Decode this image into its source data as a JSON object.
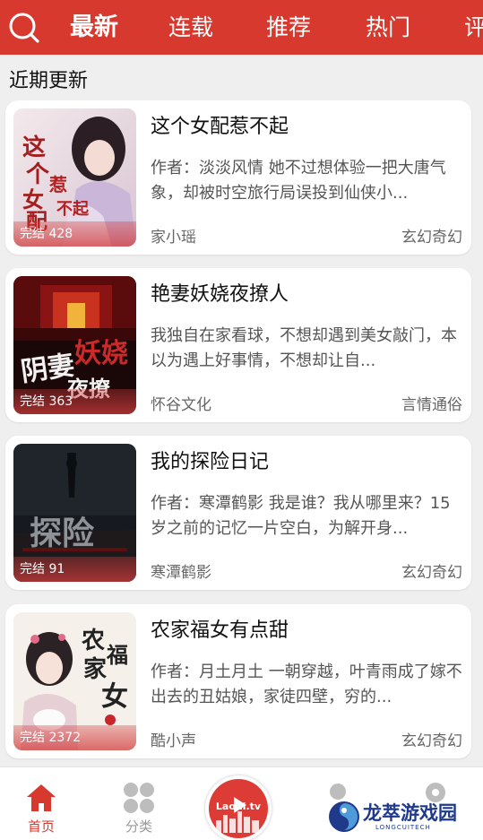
{
  "header": {
    "tabs": [
      {
        "label": "最新",
        "active": true
      },
      {
        "label": "连载",
        "active": false
      },
      {
        "label": "推荐",
        "active": false
      },
      {
        "label": "热门",
        "active": false
      },
      {
        "label": "评",
        "active": false
      }
    ],
    "search_icon": "search-icon",
    "accent_color": "#d8392f"
  },
  "section": {
    "title": "近期更新"
  },
  "books": [
    {
      "title": "这个女配惹不起",
      "description": "作者：淡淡风情 她不过想体验一把大唐气象，却被时空旅行局误投到仙侠小...",
      "badge": "完结 428",
      "author": "家小瑶",
      "genre": "玄幻奇幻"
    },
    {
      "title": "艳妻妖娆夜撩人",
      "description": "我独自在家看球，不想却遇到美女敲门，本以为遇上好事情，不想却让自...",
      "badge": "完结 363",
      "author": "怀谷文化",
      "genre": "言情通俗"
    },
    {
      "title": "我的探险日记",
      "description": "作者：寒潭鹤影 我是谁？我从哪里来？15岁之前的记忆一片空白，为解开身...",
      "badge": "完结 91",
      "author": "寒潭鹤影",
      "genre": "玄幻奇幻"
    },
    {
      "title": "农家福女有点甜",
      "description": "作者：月土月土 一朝穿越，叶青雨成了嫁不出去的丑姑娘，家徒四壁，穷的...",
      "badge": "完结 2372",
      "author": "酷小声",
      "genre": "玄幻奇幻"
    }
  ],
  "nav": {
    "home_label": "首页",
    "category_label": "分类",
    "center_text": "Laohi.tv",
    "active_color": "#d8392f",
    "inactive_color": "#999999"
  },
  "watermark": {
    "title": "龙萃游戏园",
    "subtitle": "LONGCUITECH"
  }
}
